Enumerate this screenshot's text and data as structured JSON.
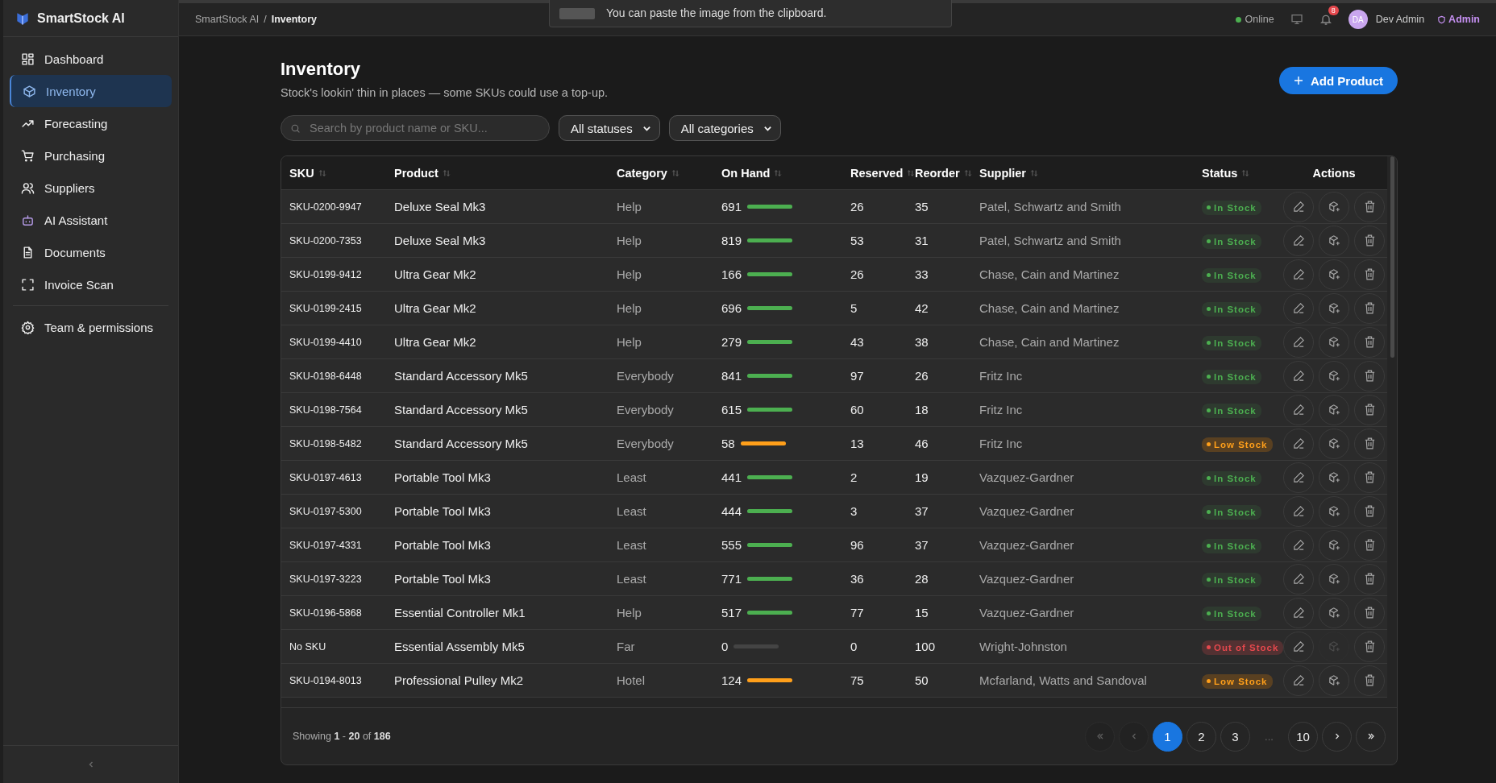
{
  "app": {
    "name": "SmartStock AI"
  },
  "toast": {
    "text": "You can paste the image from the clipboard."
  },
  "breadcrumb": {
    "items": [
      "SmartStock AI",
      "Inventory"
    ],
    "separator": "/"
  },
  "topbar": {
    "status": "Online",
    "notifications": "8",
    "avatar": "DA",
    "user": "Dev Admin",
    "role": "Admin"
  },
  "sidebar": {
    "items": [
      {
        "label": "Dashboard",
        "selected": false
      },
      {
        "label": "Inventory",
        "selected": true
      },
      {
        "label": "Forecasting",
        "selected": false
      },
      {
        "label": "Purchasing",
        "selected": false
      },
      {
        "label": "Suppliers",
        "selected": false
      },
      {
        "label": "AI Assistant",
        "selected": false
      },
      {
        "label": "Documents",
        "selected": false
      },
      {
        "label": "Invoice Scan",
        "selected": false
      }
    ],
    "footer_items": [
      {
        "label": "Team & permissions",
        "selected": false
      }
    ]
  },
  "page": {
    "title": "Inventory",
    "subtitle": "Stock's lookin' thin in places — some SKUs could use a top-up.",
    "add_button": "Add Product"
  },
  "filters": {
    "search_placeholder": "Search by product name or SKU...",
    "status": "All statuses",
    "category": "All categories"
  },
  "table": {
    "columns": [
      "SKU",
      "Product",
      "Category",
      "On Hand",
      "Reserved",
      "Reorder",
      "Supplier",
      "Status",
      "Actions"
    ],
    "rows": [
      {
        "sku": "SKU-0200-9947",
        "product": "Deluxe Seal Mk3",
        "category": "Help",
        "on_hand": "691",
        "level": 1,
        "reserved": "26",
        "reorder": "35",
        "supplier": "Patel, Schwartz and Smith",
        "status": "In Stock",
        "kind": "in",
        "restock_disabled": false
      },
      {
        "sku": "SKU-0200-7353",
        "product": "Deluxe Seal Mk3",
        "category": "Help",
        "on_hand": "819",
        "level": 1,
        "reserved": "53",
        "reorder": "31",
        "supplier": "Patel, Schwartz and Smith",
        "status": "In Stock",
        "kind": "in",
        "restock_disabled": false
      },
      {
        "sku": "SKU-0199-9412",
        "product": "Ultra Gear Mk2",
        "category": "Help",
        "on_hand": "166",
        "level": 1,
        "reserved": "26",
        "reorder": "33",
        "supplier": "Chase, Cain and Martinez",
        "status": "In Stock",
        "kind": "in",
        "restock_disabled": false
      },
      {
        "sku": "SKU-0199-2415",
        "product": "Ultra Gear Mk2",
        "category": "Help",
        "on_hand": "696",
        "level": 1,
        "reserved": "5",
        "reorder": "42",
        "supplier": "Chase, Cain and Martinez",
        "status": "In Stock",
        "kind": "in",
        "restock_disabled": false
      },
      {
        "sku": "SKU-0199-4410",
        "product": "Ultra Gear Mk2",
        "category": "Help",
        "on_hand": "279",
        "level": 1,
        "reserved": "43",
        "reorder": "38",
        "supplier": "Chase, Cain and Martinez",
        "status": "In Stock",
        "kind": "in",
        "restock_disabled": false
      },
      {
        "sku": "SKU-0198-6448",
        "product": "Standard Accessory Mk5",
        "category": "Everybody",
        "on_hand": "841",
        "level": 1,
        "reserved": "97",
        "reorder": "26",
        "supplier": "Fritz Inc",
        "status": "In Stock",
        "kind": "in",
        "restock_disabled": false
      },
      {
        "sku": "SKU-0198-7564",
        "product": "Standard Accessory Mk5",
        "category": "Everybody",
        "on_hand": "615",
        "level": 1,
        "reserved": "60",
        "reorder": "18",
        "supplier": "Fritz Inc",
        "status": "In Stock",
        "kind": "in",
        "restock_disabled": false
      },
      {
        "sku": "SKU-0198-5482",
        "product": "Standard Accessory Mk5",
        "category": "Everybody",
        "on_hand": "58",
        "level": 1,
        "reserved": "13",
        "reorder": "46",
        "supplier": "Fritz Inc",
        "status": "Low Stock",
        "kind": "low",
        "restock_disabled": false
      },
      {
        "sku": "SKU-0197-4613",
        "product": "Portable Tool Mk3",
        "category": "Least",
        "on_hand": "441",
        "level": 1,
        "reserved": "2",
        "reorder": "19",
        "supplier": "Vazquez-Gardner",
        "status": "In Stock",
        "kind": "in",
        "restock_disabled": false
      },
      {
        "sku": "SKU-0197-5300",
        "product": "Portable Tool Mk3",
        "category": "Least",
        "on_hand": "444",
        "level": 1,
        "reserved": "3",
        "reorder": "37",
        "supplier": "Vazquez-Gardner",
        "status": "In Stock",
        "kind": "in",
        "restock_disabled": false
      },
      {
        "sku": "SKU-0197-4331",
        "product": "Portable Tool Mk3",
        "category": "Least",
        "on_hand": "555",
        "level": 1,
        "reserved": "96",
        "reorder": "37",
        "supplier": "Vazquez-Gardner",
        "status": "In Stock",
        "kind": "in",
        "restock_disabled": false
      },
      {
        "sku": "SKU-0197-3223",
        "product": "Portable Tool Mk3",
        "category": "Least",
        "on_hand": "771",
        "level": 1,
        "reserved": "36",
        "reorder": "28",
        "supplier": "Vazquez-Gardner",
        "status": "In Stock",
        "kind": "in",
        "restock_disabled": false
      },
      {
        "sku": "SKU-0196-5868",
        "product": "Essential Controller Mk1",
        "category": "Help",
        "on_hand": "517",
        "level": 1,
        "reserved": "77",
        "reorder": "15",
        "supplier": "Vazquez-Gardner",
        "status": "In Stock",
        "kind": "in",
        "restock_disabled": false
      },
      {
        "sku": "No SKU",
        "product": "Essential Assembly Mk5",
        "category": "Far",
        "on_hand": "0",
        "level": 0,
        "reserved": "0",
        "reorder": "100",
        "supplier": "Wright-Johnston",
        "status": "Out of Stock",
        "kind": "out",
        "restock_disabled": true
      },
      {
        "sku": "SKU-0194-8013",
        "product": "Professional Pulley Mk2",
        "category": "Hotel",
        "on_hand": "124",
        "level": 1,
        "reserved": "75",
        "reorder": "50",
        "supplier": "Mcfarland, Watts and Sandoval",
        "status": "Low Stock",
        "kind": "low",
        "restock_disabled": false
      }
    ]
  },
  "footer": {
    "showing": "Showing **1** - **20** of **186**",
    "pages": [
      {
        "label": "1",
        "selected": true
      },
      {
        "label": "2",
        "selected": false
      },
      {
        "label": "3",
        "selected": false
      }
    ],
    "ellipsis": "...",
    "last_pages": [
      {
        "label": "10",
        "selected": false
      }
    ],
    "prev_disabled": true,
    "next_disabled": false
  }
}
